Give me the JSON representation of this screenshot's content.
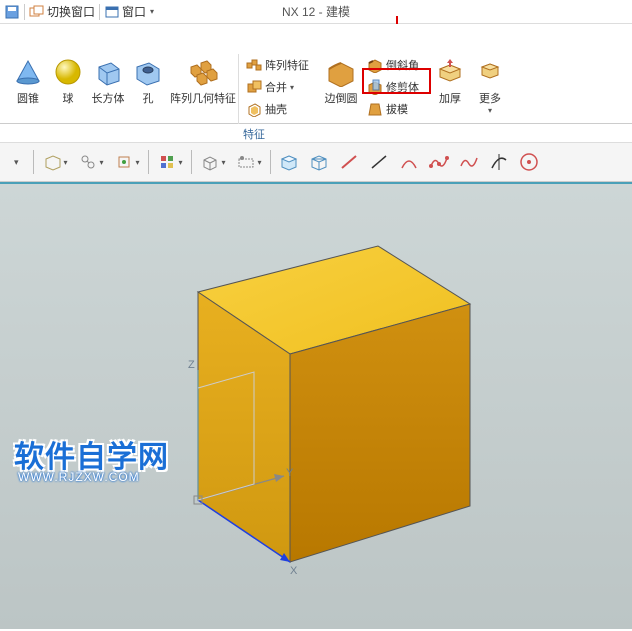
{
  "window": {
    "title": "NX 12 - 建模",
    "switch_window": "切换窗口",
    "window_menu": "窗口"
  },
  "ribbon": {
    "groups": {
      "features_label": "特征",
      "cone": "圆锥",
      "sphere": "球",
      "cuboid": "长方体",
      "hole": "孔",
      "pattern_geo": "阵列几何特征",
      "pattern_feature": "阵列特征",
      "combine": "合并",
      "shell": "抽壳",
      "edge_blend": "边倒圆",
      "chamfer": "倒斜角",
      "trim_body": "修剪体",
      "draft": "拔模",
      "thicken": "加厚",
      "more": "更多"
    }
  },
  "watermark": {
    "main": "软件自学网",
    "sub": "WWW.RJZXW.COM"
  },
  "axes": {
    "x": "X",
    "y": "Y",
    "z": "Z"
  }
}
